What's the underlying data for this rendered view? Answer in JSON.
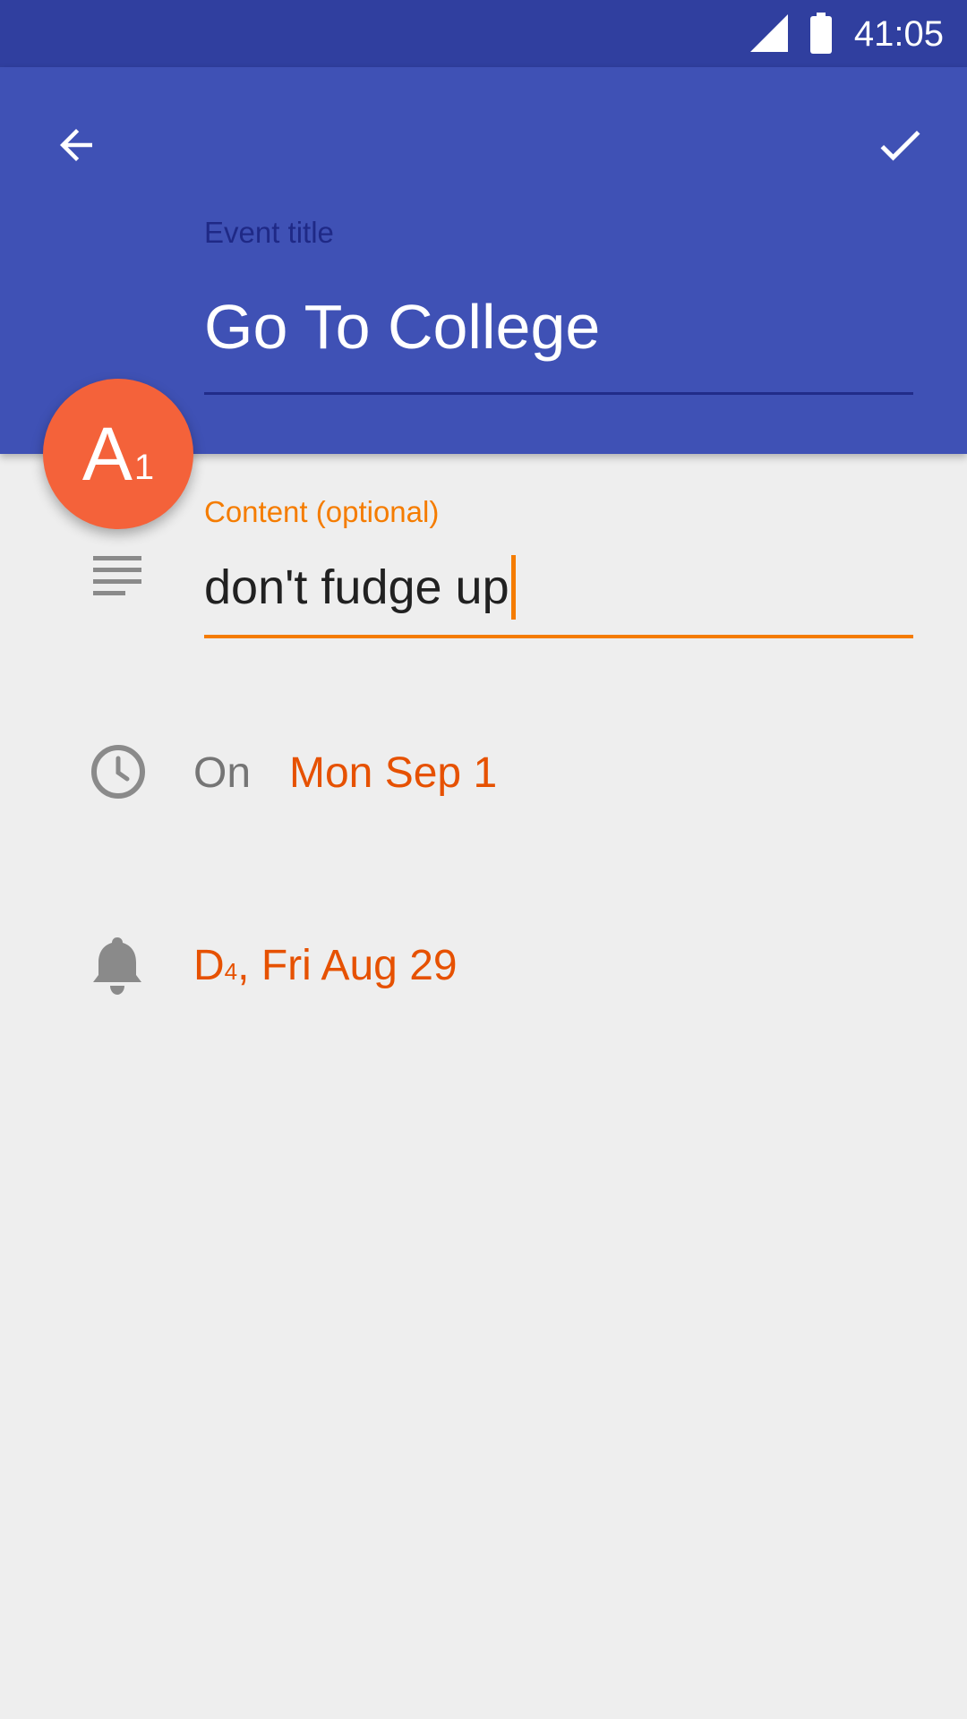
{
  "status_bar": {
    "time": "41:05",
    "icons": [
      "signal-icon",
      "battery-icon"
    ]
  },
  "header": {
    "back_icon": "arrow-left-icon",
    "save_icon": "check-icon",
    "title_label": "Event title",
    "title_value": "Go To College",
    "background_color": "#3f51b5",
    "status_color": "#303f9f"
  },
  "avatar": {
    "letter": "A",
    "subscript": "1",
    "color": "#f4623a"
  },
  "content": {
    "label": "Content (optional)",
    "value": "don't fudge up",
    "icon": "notes-icon",
    "accent_color": "#f57c00"
  },
  "date": {
    "icon": "clock-icon",
    "prefix": "On",
    "value": "Mon Sep 1"
  },
  "reminder": {
    "icon": "bell-icon",
    "letter": "D",
    "subscript": "4",
    "value": ", Fri Aug 29"
  }
}
